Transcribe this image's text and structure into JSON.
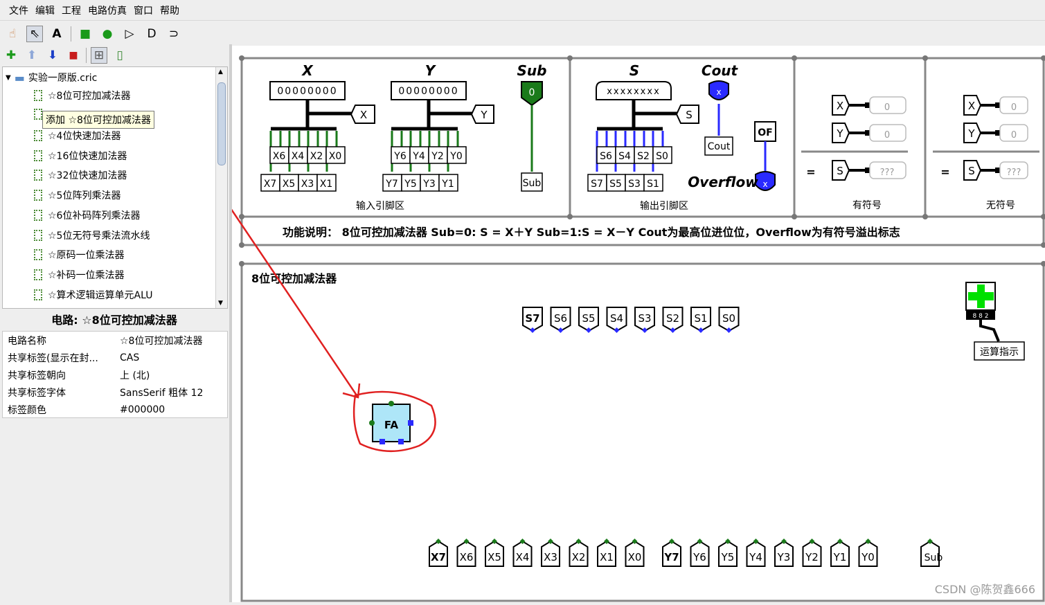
{
  "menu": [
    "文件",
    "编辑",
    "工程",
    "电路仿真",
    "窗口",
    "帮助"
  ],
  "toolbar1": [
    {
      "name": "hand-tool-icon",
      "glyph": "☝"
    },
    {
      "name": "select-tool-icon",
      "glyph": "⇖"
    },
    {
      "name": "text-tool-icon",
      "glyph": "A"
    },
    {
      "name": "input-pin-icon",
      "glyph": "■"
    },
    {
      "name": "output-pin-icon",
      "glyph": "●"
    },
    {
      "name": "not-gate-icon",
      "glyph": "▷"
    },
    {
      "name": "and-gate-icon",
      "glyph": "D"
    },
    {
      "name": "or-gate-icon",
      "glyph": "⊃"
    }
  ],
  "toolbar2": [
    {
      "name": "add-circuit-icon",
      "glyph": "✚",
      "color": "#1a9a1a"
    },
    {
      "name": "move-up-icon",
      "glyph": "⬆",
      "color": "#8fa8d8"
    },
    {
      "name": "move-down-icon",
      "glyph": "⬇",
      "color": "#1c3fc8"
    },
    {
      "name": "delete-icon",
      "glyph": "🗑",
      "color": "#c81c1c"
    },
    {
      "name": "appearance-icon",
      "glyph": "⊞",
      "color": "#555555"
    },
    {
      "name": "layout-icon",
      "glyph": "▯",
      "color": "#3a8a34"
    }
  ],
  "tree": {
    "root": "实验一原版.cric",
    "items": [
      "☆8位可控加减法器",
      "",
      "☆4位快速加法器",
      "☆16位快速加法器",
      "☆32位快速加法器",
      "☆5位阵列乘法器",
      "☆6位补码阵列乘法器",
      "☆5位无符号乘法流水线",
      "☆原码一位乘法器",
      "☆补码一位乘法器",
      "☆算术逻辑运算单元ALU"
    ]
  },
  "tooltip": "添加 ☆8位可控加减法器",
  "panel_title": "电路: ☆8位可控加减法器",
  "properties": [
    {
      "key": "电路名称",
      "value": "☆8位可控加减法器"
    },
    {
      "key": "共享标签(显示在封...",
      "value": "CAS"
    },
    {
      "key": "共享标签朝向",
      "value": "上 (北)"
    },
    {
      "key": "共享标签字体",
      "value": "SansSerif 粗体 12"
    },
    {
      "key": "标签颜色",
      "value": "#000000"
    }
  ],
  "diagram": {
    "input_x_label": "X",
    "input_y_label": "Y",
    "sub_label": "Sub",
    "input_x_value": "00000000",
    "input_y_value": "00000000",
    "sub_value": "0",
    "x_tunnel": "X",
    "y_tunnel": "Y",
    "sub_tunnel": "Sub",
    "x_odd": [
      "X6",
      "X4",
      "X2",
      "X0"
    ],
    "x_even": [
      "X7",
      "X5",
      "X3",
      "X1"
    ],
    "y_odd": [
      "Y6",
      "Y4",
      "Y2",
      "Y0"
    ],
    "y_even": [
      "Y7",
      "Y5",
      "Y3",
      "Y1"
    ],
    "input_area": "输入引脚区",
    "s_label": "S",
    "s_value": "xxxxxxxx",
    "s_tunnel": "S",
    "s_odd": [
      "S6",
      "S4",
      "S2",
      "S0"
    ],
    "s_even": [
      "S7",
      "S5",
      "S3",
      "S1"
    ],
    "cout_label": "Cout",
    "cout_tunnel": "Cout",
    "cout_value": "x",
    "of_label": "OF",
    "overflow_label": "Overflow",
    "of_value": "x",
    "output_area": "输出引脚区",
    "signed_label": "有符号",
    "unsigned_label": "无符号",
    "probe_x": "X",
    "probe_y": "Y",
    "probe_s": "S",
    "probe_xy_value": "0",
    "probe_s_value": "???",
    "equals": "=",
    "description": "功能说明：  8位可控加减法器    Sub=0: S = X＋Y   Sub=1:S = X－Y    Cout为最高位进位位，Overflow为有符号溢出标志",
    "circuit_title": "8位可控加减法器",
    "s_tunnels": [
      "S7",
      "S6",
      "S5",
      "S4",
      "S3",
      "S2",
      "S1",
      "S0"
    ],
    "x_tunnels": [
      "X7",
      "X6",
      "X5",
      "X4",
      "X3",
      "X2",
      "X1",
      "X0"
    ],
    "y_tunnels": [
      "Y7",
      "Y6",
      "Y5",
      "Y4",
      "Y3",
      "Y2",
      "Y1",
      "Y0"
    ],
    "sub_tunnel_bottom": "Sub",
    "fa_label": "FA",
    "op_indicator": "运算指示",
    "op_bits": "8 8 2"
  },
  "watermark": "CSDN @陈贺鑫666",
  "colors": {
    "wire_on": "#1a7a1a",
    "wire_unknown": "#2a2aff",
    "annotation": "#e02020",
    "fa_fill": "#aee6f8"
  }
}
